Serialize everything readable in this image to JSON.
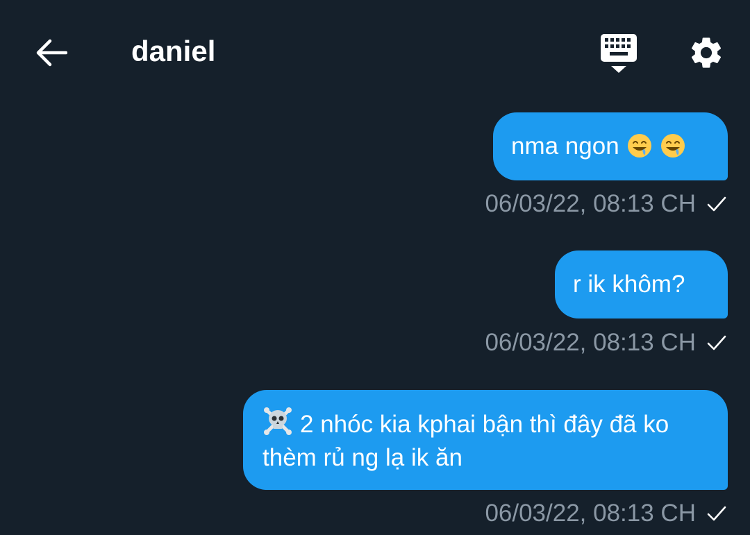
{
  "header": {
    "title": "daniel",
    "back_icon": "arrow-left-icon",
    "keyboard_icon": "keyboard-icon",
    "settings_icon": "gear-icon"
  },
  "messages": [
    {
      "text": "nma ngon",
      "emoji": [
        "drooling-face",
        "drooling-face"
      ],
      "timestamp": "06/03/22, 08:13 CH",
      "status_icon": "check-icon"
    },
    {
      "text": "r ik khôm?",
      "timestamp": "06/03/22, 08:13 CH",
      "status_icon": "check-icon"
    },
    {
      "emoji_prefix": "skull-crossbones",
      "text": "2 nhóc kia kphai bận thì đây đã ko thèm rủ ng lạ ik ăn",
      "timestamp": "06/03/22, 08:13 CH",
      "status_icon": "check-icon"
    }
  ],
  "colors": {
    "background": "#15202b",
    "bubble": "#1d9bf0",
    "meta_text": "#8b98a5",
    "text": "#ffffff"
  }
}
